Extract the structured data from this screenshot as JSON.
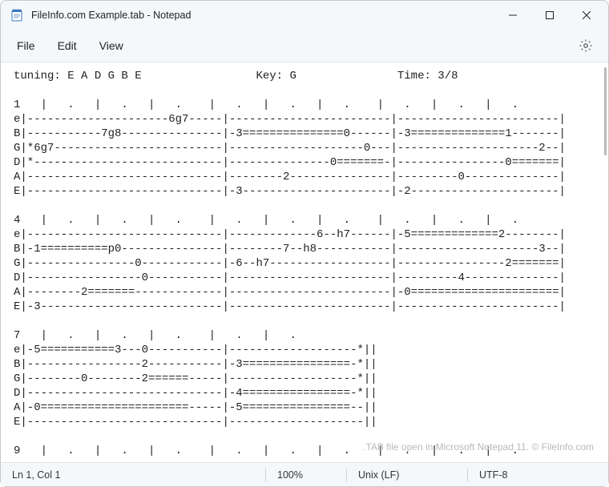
{
  "window": {
    "title": "FileInfo.com Example.tab - Notepad"
  },
  "menu": {
    "file": "File",
    "edit": "Edit",
    "view": "View"
  },
  "editor": {
    "content": "tuning: E A D G B E                 Key: G               Time: 3/8\n\n1   |   .   |   .   |   .    |   .   |   .   |   .    |   .   |   .   |   .\ne|---------------------6g7-----|------------------------|------------------------|\nB|-----------7g8---------------|-3===============0------|-3==============1-------|\nG|*6g7-------------------------|--------------------0---|---------------------2--|\nD|*----------------------------|---------------0=======-|----------------0=======|\nA|-----------------------------|--------2---------------|---------0--------------|\nE|-----------------------------|-3----------------------|-2----------------------|\n\n4   |   .   |   .   |   .    |   .   |   .   |   .    |   .   |   .   |   .\ne|-----------------------------|-------------6--h7------|-5=============2--------|\nB|-1==========p0---------------|--------7--h8-----------|---------------------3--|\nG|----------------0------------|-6--h7------------------|----------------2=======|\nD|-----------------0-----------|------------------------|---------4--------------|\nA|--------2=======-------------|------------------------|-0======================|\nE|-3---------------------------|------------------------|------------------------|\n\n7   |   .   |   .   |   .    |   .   |   .\ne|-5===========3---0-----------|-------------------*||\nB|-----------------2-----------|-3================-*||\nG|--------0--------2======-----|-------------------*||\nD|-----------------------------|-4================-*||\nA|-0======================-----|-5================--||\nE|-----------------------------|--------------------||\n\n9   |   .   |   .   |   .    |   .   |   .   |   .    |   .   |   .   |   ."
  },
  "watermark": ".TAB file open in Microsoft Notepad 11. © FileInfo.com",
  "status": {
    "position": "Ln 1, Col 1",
    "zoom": "100%",
    "eol": "Unix (LF)",
    "encoding": "UTF-8"
  }
}
